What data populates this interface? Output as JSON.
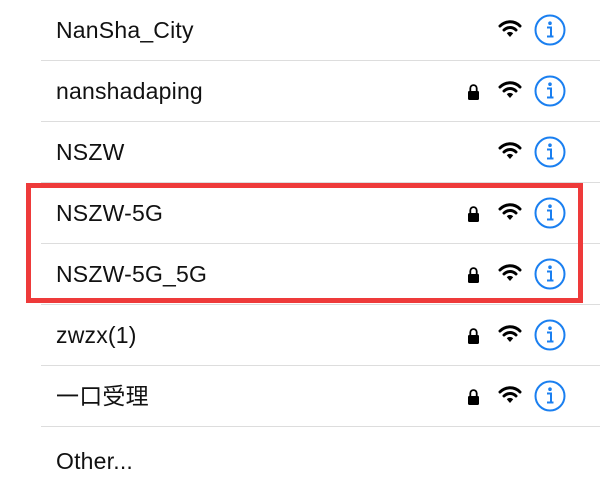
{
  "networks": [
    {
      "name": "NanSha_City",
      "locked": false
    },
    {
      "name": "nanshadaping",
      "locked": true
    },
    {
      "name": "NSZW",
      "locked": false
    },
    {
      "name": "NSZW-5G",
      "locked": true
    },
    {
      "name": "NSZW-5G_5G",
      "locked": true
    },
    {
      "name": "zwzx(1)",
      "locked": true
    },
    {
      "name": "一口受理",
      "locked": true
    }
  ],
  "other_label": "Other...",
  "icons": {
    "lock": "lock-icon",
    "wifi": "wifi-icon",
    "info": "info-icon"
  },
  "colors": {
    "accent": "#1a7ff0",
    "highlight": "#ee3a3a"
  }
}
